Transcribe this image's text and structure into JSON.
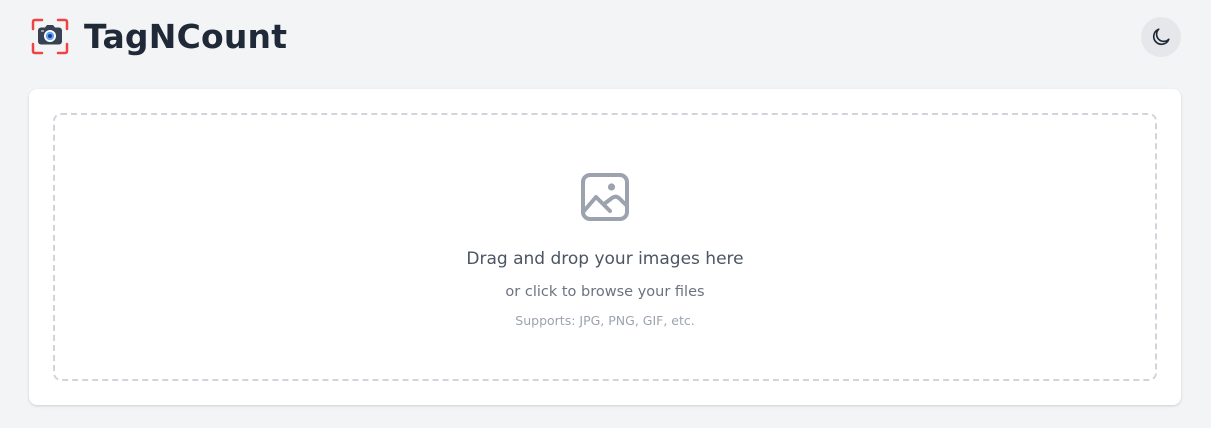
{
  "header": {
    "app_title": "TagNCount",
    "logo_icon": "camera-icon",
    "theme_toggle_icon": "moon-icon"
  },
  "upload": {
    "icon": "image-icon",
    "title": "Drag and drop your images here",
    "subtitle": "or click to browse your files",
    "supported_formats": "Supports: JPG, PNG, GIF, etc."
  },
  "colors": {
    "background": "#f3f4f6",
    "card": "#ffffff",
    "logo_frame": "#ef4444",
    "camera_body": "#374151",
    "camera_lens": "#60a5fa",
    "toggle_bg": "#e5e7eb"
  }
}
